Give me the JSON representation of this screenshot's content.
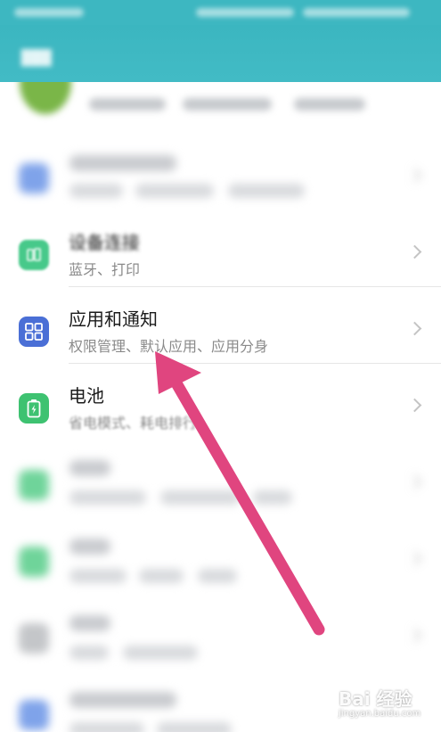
{
  "colors": {
    "header": "#3db7c1",
    "arrow": "#e0457f",
    "apps_icon": "#4a6fd6",
    "battery_icon": "#3ec271",
    "connection_icon": "#47c98a"
  },
  "rows": {
    "device_connection": {
      "title": "设备连接",
      "subtitle": "蓝牙、打印",
      "icon": "device-connection-icon"
    },
    "apps_notifications": {
      "title": "应用和通知",
      "subtitle": "权限管理、默认应用、应用分身",
      "icon": "apps-grid-icon"
    },
    "battery": {
      "title": "电池",
      "subtitle": "省电模式、耗电排行",
      "icon": "battery-icon"
    }
  },
  "watermark": {
    "logo": "Bai 经验",
    "url": "jingyan.baidu.com"
  }
}
